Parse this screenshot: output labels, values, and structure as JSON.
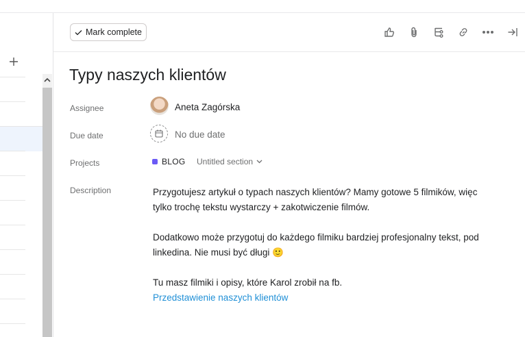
{
  "left": {
    "add_icon": "plus-icon"
  },
  "toolbar": {
    "mark_complete": "Mark complete",
    "icons": [
      "thumbs-up-icon",
      "paperclip-icon",
      "subtask-icon",
      "link-icon",
      "more-icon",
      "close-pane-icon"
    ]
  },
  "task": {
    "title": "Typy naszych klientów",
    "assignee_label": "Assignee",
    "assignee_name": "Aneta Zagórska",
    "due_label": "Due date",
    "due_value": "No due date",
    "projects_label": "Projects",
    "project_name": "BLOG",
    "project_color": "#6b5af5",
    "section_name": "Untitled section",
    "description_label": "Description",
    "description": {
      "line1": "Przygotujesz artykuł o typach naszych klientów? Mamy gotowe 5 filmików, więc",
      "line2": "tylko trochę tekstu wystarczy + zakotwiczenie filmów.",
      "line3": "Dodatkowo może przygotuj do każdego filmiku bardziej profesjonalny tekst, pod",
      "line4": "linkedina. Nie musi być długi 🙂",
      "line5": "Tu masz filmiki i opisy, które Karol zrobił na fb.",
      "link": "Przedstawienie naszych klientów"
    }
  }
}
